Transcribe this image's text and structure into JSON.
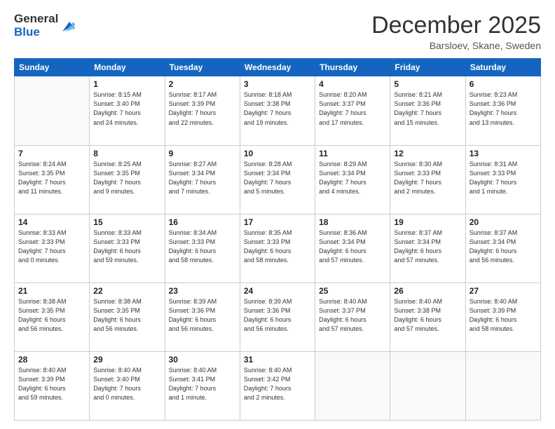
{
  "logo": {
    "general": "General",
    "blue": "Blue"
  },
  "header": {
    "month": "December 2025",
    "location": "Barsloev, Skane, Sweden"
  },
  "days_of_week": [
    "Sunday",
    "Monday",
    "Tuesday",
    "Wednesday",
    "Thursday",
    "Friday",
    "Saturday"
  ],
  "weeks": [
    [
      {
        "day": "",
        "content": ""
      },
      {
        "day": "1",
        "content": "Sunrise: 8:15 AM\nSunset: 3:40 PM\nDaylight: 7 hours\nand 24 minutes."
      },
      {
        "day": "2",
        "content": "Sunrise: 8:17 AM\nSunset: 3:39 PM\nDaylight: 7 hours\nand 22 minutes."
      },
      {
        "day": "3",
        "content": "Sunrise: 8:18 AM\nSunset: 3:38 PM\nDaylight: 7 hours\nand 19 minutes."
      },
      {
        "day": "4",
        "content": "Sunrise: 8:20 AM\nSunset: 3:37 PM\nDaylight: 7 hours\nand 17 minutes."
      },
      {
        "day": "5",
        "content": "Sunrise: 8:21 AM\nSunset: 3:36 PM\nDaylight: 7 hours\nand 15 minutes."
      },
      {
        "day": "6",
        "content": "Sunrise: 8:23 AM\nSunset: 3:36 PM\nDaylight: 7 hours\nand 13 minutes."
      }
    ],
    [
      {
        "day": "7",
        "content": "Sunrise: 8:24 AM\nSunset: 3:35 PM\nDaylight: 7 hours\nand 11 minutes."
      },
      {
        "day": "8",
        "content": "Sunrise: 8:25 AM\nSunset: 3:35 PM\nDaylight: 7 hours\nand 9 minutes."
      },
      {
        "day": "9",
        "content": "Sunrise: 8:27 AM\nSunset: 3:34 PM\nDaylight: 7 hours\nand 7 minutes."
      },
      {
        "day": "10",
        "content": "Sunrise: 8:28 AM\nSunset: 3:34 PM\nDaylight: 7 hours\nand 5 minutes."
      },
      {
        "day": "11",
        "content": "Sunrise: 8:29 AM\nSunset: 3:34 PM\nDaylight: 7 hours\nand 4 minutes."
      },
      {
        "day": "12",
        "content": "Sunrise: 8:30 AM\nSunset: 3:33 PM\nDaylight: 7 hours\nand 2 minutes."
      },
      {
        "day": "13",
        "content": "Sunrise: 8:31 AM\nSunset: 3:33 PM\nDaylight: 7 hours\nand 1 minute."
      }
    ],
    [
      {
        "day": "14",
        "content": "Sunrise: 8:33 AM\nSunset: 3:33 PM\nDaylight: 7 hours\nand 0 minutes."
      },
      {
        "day": "15",
        "content": "Sunrise: 8:33 AM\nSunset: 3:33 PM\nDaylight: 6 hours\nand 59 minutes."
      },
      {
        "day": "16",
        "content": "Sunrise: 8:34 AM\nSunset: 3:33 PM\nDaylight: 6 hours\nand 58 minutes."
      },
      {
        "day": "17",
        "content": "Sunrise: 8:35 AM\nSunset: 3:33 PM\nDaylight: 6 hours\nand 58 minutes."
      },
      {
        "day": "18",
        "content": "Sunrise: 8:36 AM\nSunset: 3:34 PM\nDaylight: 6 hours\nand 57 minutes."
      },
      {
        "day": "19",
        "content": "Sunrise: 8:37 AM\nSunset: 3:34 PM\nDaylight: 6 hours\nand 57 minutes."
      },
      {
        "day": "20",
        "content": "Sunrise: 8:37 AM\nSunset: 3:34 PM\nDaylight: 6 hours\nand 56 minutes."
      }
    ],
    [
      {
        "day": "21",
        "content": "Sunrise: 8:38 AM\nSunset: 3:35 PM\nDaylight: 6 hours\nand 56 minutes."
      },
      {
        "day": "22",
        "content": "Sunrise: 8:38 AM\nSunset: 3:35 PM\nDaylight: 6 hours\nand 56 minutes."
      },
      {
        "day": "23",
        "content": "Sunrise: 8:39 AM\nSunset: 3:36 PM\nDaylight: 6 hours\nand 56 minutes."
      },
      {
        "day": "24",
        "content": "Sunrise: 8:39 AM\nSunset: 3:36 PM\nDaylight: 6 hours\nand 56 minutes."
      },
      {
        "day": "25",
        "content": "Sunrise: 8:40 AM\nSunset: 3:37 PM\nDaylight: 6 hours\nand 57 minutes."
      },
      {
        "day": "26",
        "content": "Sunrise: 8:40 AM\nSunset: 3:38 PM\nDaylight: 6 hours\nand 57 minutes."
      },
      {
        "day": "27",
        "content": "Sunrise: 8:40 AM\nSunset: 3:39 PM\nDaylight: 6 hours\nand 58 minutes."
      }
    ],
    [
      {
        "day": "28",
        "content": "Sunrise: 8:40 AM\nSunset: 3:39 PM\nDaylight: 6 hours\nand 59 minutes."
      },
      {
        "day": "29",
        "content": "Sunrise: 8:40 AM\nSunset: 3:40 PM\nDaylight: 7 hours\nand 0 minutes."
      },
      {
        "day": "30",
        "content": "Sunrise: 8:40 AM\nSunset: 3:41 PM\nDaylight: 7 hours\nand 1 minute."
      },
      {
        "day": "31",
        "content": "Sunrise: 8:40 AM\nSunset: 3:42 PM\nDaylight: 7 hours\nand 2 minutes."
      },
      {
        "day": "",
        "content": ""
      },
      {
        "day": "",
        "content": ""
      },
      {
        "day": "",
        "content": ""
      }
    ]
  ]
}
